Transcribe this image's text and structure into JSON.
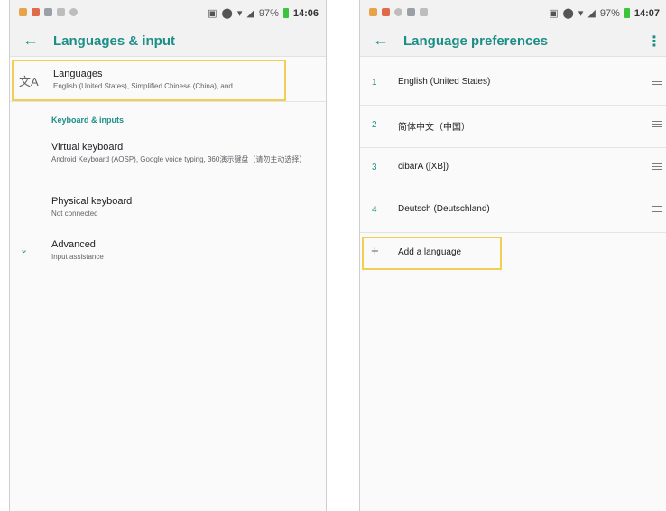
{
  "left_screen": {
    "status": {
      "battery": "97%",
      "time": "14:06"
    },
    "toolbar": {
      "title": "Languages & input"
    },
    "languages": {
      "title": "Languages",
      "subtitle": "English (United States), Simplified Chinese (China), and ..."
    },
    "section_header": "Keyboard & inputs",
    "virtual_keyboard": {
      "title": "Virtual keyboard",
      "subtitle": "Android Keyboard (AOSP), Google voice typing, 360演示键盘（请勿主动选择）"
    },
    "physical_keyboard": {
      "title": "Physical keyboard",
      "subtitle": "Not connected"
    },
    "advanced": {
      "title": "Advanced",
      "subtitle": "Input assistance"
    },
    "icons": [
      "translate-icon",
      "back-arrow-icon",
      "chevron-down-icon"
    ]
  },
  "right_screen": {
    "status": {
      "battery": "97%",
      "time": "14:07"
    },
    "toolbar": {
      "title": "Language preferences"
    },
    "languages": [
      {
        "num": "1",
        "name": "English (United States)"
      },
      {
        "num": "2",
        "name": "简体中文（中国）"
      },
      {
        "num": "3",
        "name": "cibarA ([XB])"
      },
      {
        "num": "4",
        "name": "Deutsch (Deutschland)"
      }
    ],
    "add_language": "Add a language",
    "icons": [
      "back-arrow-icon",
      "more-vert-icon",
      "drag-handle-icon",
      "plus-icon"
    ]
  },
  "colors": {
    "accent": "#1b8f86",
    "highlight": "#f2cf52",
    "battery": "#3cc43c"
  }
}
